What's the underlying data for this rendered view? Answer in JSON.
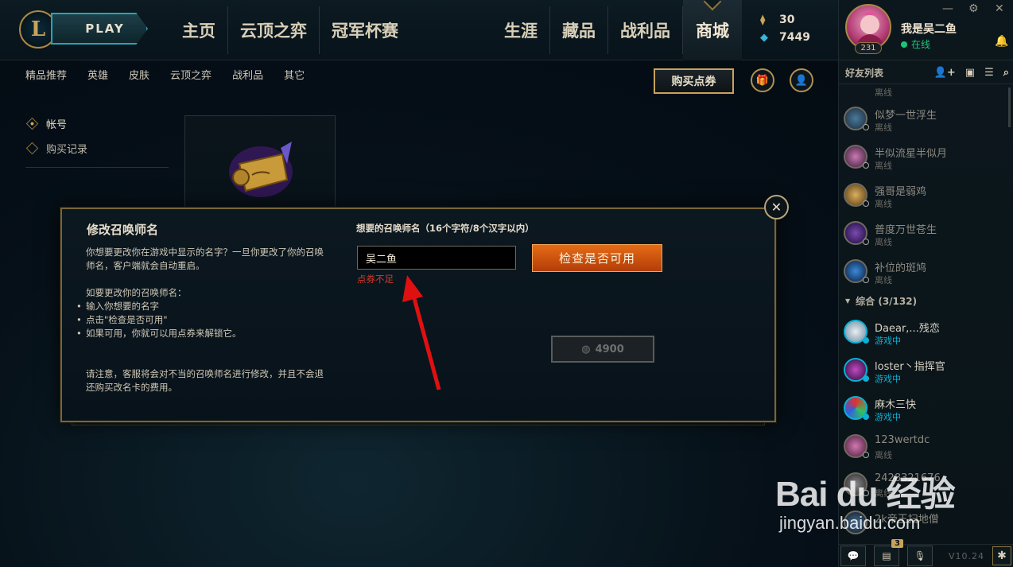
{
  "header": {
    "logo_letter": "L",
    "play_label": "PLAY",
    "nav_left": [
      "主页",
      "云顶之弈",
      "冠军杯赛"
    ],
    "nav_right": [
      "生涯",
      "藏品",
      "战利品",
      "商城"
    ],
    "active_nav": "商城",
    "currency": {
      "blue_essence": "30",
      "rp": "7449"
    }
  },
  "subnav": {
    "items": [
      "精品推荐",
      "英雄",
      "皮肤",
      "云顶之弈",
      "战利品",
      "其它"
    ],
    "buy_rp_label": "购买点券"
  },
  "side_menu": {
    "items": [
      "帐号",
      "购买记录"
    ],
    "active": "帐号"
  },
  "modal": {
    "title": "修改召唤师名",
    "desc_1": "你想要更改你在游戏中显示的名字？一旦你更改了你的召唤师名，客户端就会自动重启。",
    "desc_2": "如要更改你的召唤师名：",
    "steps": [
      "输入你想要的名字",
      "点击\"检查是否可用\"",
      "如果可用，你就可以用点券来解锁它。"
    ],
    "desc_3": "请注意，客服将会对不当的召唤师名进行修改，并且不会退还购买改名卡的费用。",
    "field_label": "想要的召唤师名（16个字符/8个汉字以内）",
    "input_value": "吴二鱼",
    "error_text": "点券不足",
    "check_label": "检查是否可用",
    "price": "4900",
    "close_symbol": "✕"
  },
  "profile": {
    "name": "我是吴二鱼",
    "status": "在线",
    "level": "231"
  },
  "social": {
    "friends_header": "好友列表",
    "group_label": "综合 (3/132)",
    "offline_friends": [
      {
        "name": "似梦一世浮生",
        "status": "离线"
      },
      {
        "name": "半似流星半似月",
        "status": "离线"
      },
      {
        "name": "强哥是弱鸡",
        "status": "离线"
      },
      {
        "name": "普度万世苍生",
        "status": "离线"
      },
      {
        "name": "补位的斑鸠",
        "status": "离线"
      }
    ],
    "group_friends": [
      {
        "name": "Daear,...残恋",
        "status": "游戏中",
        "ingame": true
      },
      {
        "name": "loster丶指挥官",
        "status": "游戏中",
        "ingame": true
      },
      {
        "name": "麻木三快",
        "status": "游戏中",
        "ingame": true
      },
      {
        "name": "123wertdc",
        "status": "离线",
        "ingame": false
      },
      {
        "name": "2428321676",
        "status": "离线",
        "ingame": false
      },
      {
        "name": "2k帝王扫地僧",
        "status": "",
        "ingame": false
      }
    ],
    "partial_status_top": "离线",
    "footer": {
      "badge_count": "3",
      "version": "V10.24"
    }
  },
  "watermark": {
    "logo": "Bai du 经验",
    "url": "jingyan.baidu.com"
  },
  "colors": {
    "accent_gold": "#c8a35a",
    "play_teal": "#1fa8b8",
    "orange_btn": "#e56c16",
    "error_red": "#d23a2c",
    "online_green": "#1ac77a",
    "ingame_blue": "#0ab1d4"
  }
}
